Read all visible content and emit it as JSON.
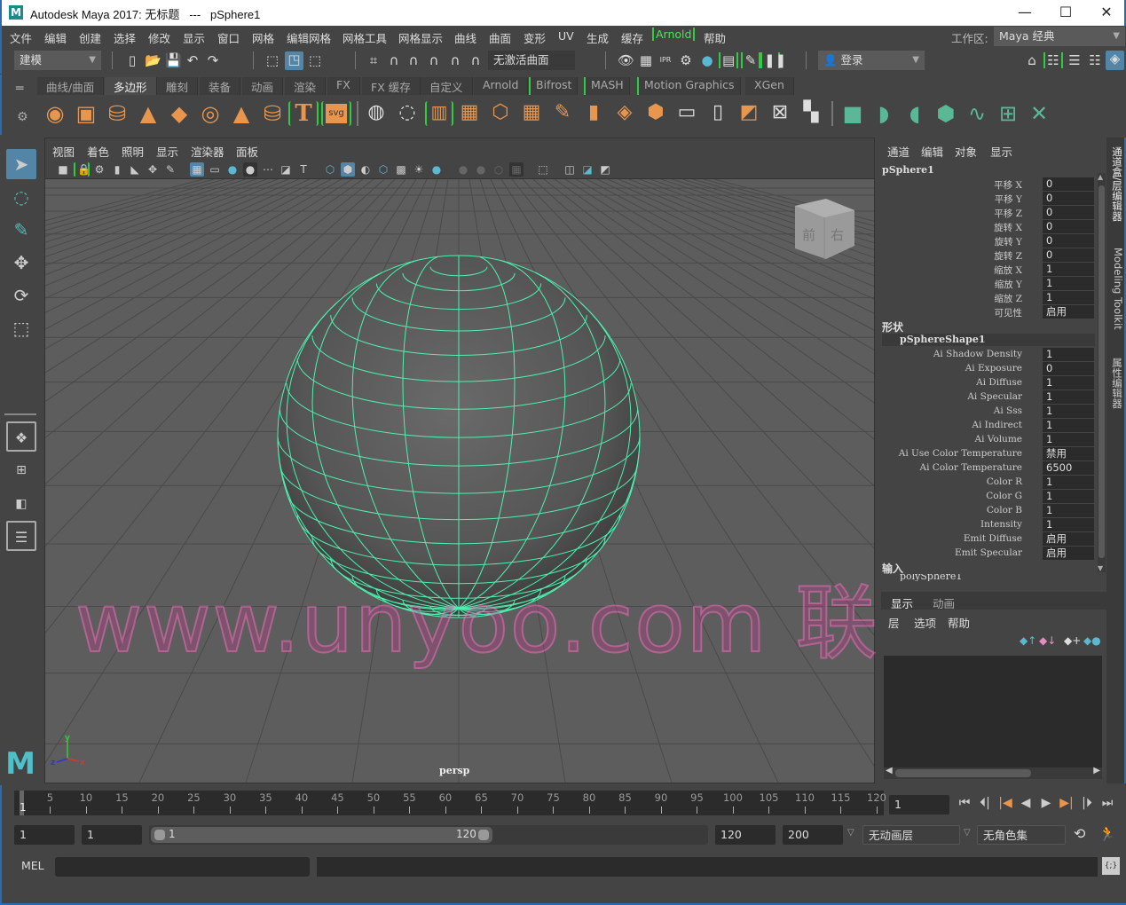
{
  "window": {
    "title": "Autodesk Maya 2017: 无标题   ---   pSphere1",
    "logo": "M",
    "minimize": "—",
    "maximize": "☐",
    "close": "✕"
  },
  "menubar": {
    "items": [
      "文件",
      "编辑",
      "创建",
      "选择",
      "修改",
      "显示",
      "窗口",
      "网格",
      "编辑网格",
      "网格工具",
      "网格显示",
      "曲线",
      "曲面",
      "变形",
      "UV",
      "生成",
      "缓存",
      "Arnold",
      "帮助"
    ],
    "workspace_label": "工作区:",
    "workspace_value": "Maya 经典"
  },
  "statusline": {
    "mode": "建模",
    "live_surface": "无激活曲面",
    "login": "登录"
  },
  "shelf": {
    "tabs": [
      "曲线/曲面",
      "多边形",
      "雕刻",
      "装备",
      "动画",
      "渲染",
      "FX",
      "FX 缓存",
      "自定义",
      "Arnold",
      "Bifrost",
      "MASH",
      "Motion Graphics",
      "XGen"
    ],
    "active_tab": "多边形",
    "text_icon": "T",
    "svg_icon": "svg"
  },
  "viewport": {
    "menus": [
      "视图",
      "着色",
      "照明",
      "显示",
      "渲染器",
      "面板"
    ],
    "camera_label": "persp",
    "viewcube_front": "前",
    "viewcube_right": "右",
    "axis_x": "x",
    "axis_y": "y",
    "axis_z": "z"
  },
  "channel_box": {
    "menus": [
      "通道",
      "编辑",
      "对象",
      "显示"
    ],
    "object_name": "pSphere1",
    "transform": [
      {
        "label": "平移 X",
        "value": "0"
      },
      {
        "label": "平移 Y",
        "value": "0"
      },
      {
        "label": "平移 Z",
        "value": "0"
      },
      {
        "label": "旋转 X",
        "value": "0"
      },
      {
        "label": "旋转 Y",
        "value": "0"
      },
      {
        "label": "旋转 Z",
        "value": "0"
      },
      {
        "label": "缩放 X",
        "value": "1"
      },
      {
        "label": "缩放 Y",
        "value": "1"
      },
      {
        "label": "缩放 Z",
        "value": "1"
      },
      {
        "label": "可见性",
        "value": "启用"
      }
    ],
    "shapes_heading": "形状",
    "shape_name": "pSphereShape1",
    "shape_attrs": [
      {
        "label": "Ai Shadow Density",
        "value": "1"
      },
      {
        "label": "Ai Exposure",
        "value": "0"
      },
      {
        "label": "Ai Diffuse",
        "value": "1"
      },
      {
        "label": "Ai Specular",
        "value": "1"
      },
      {
        "label": "Ai Sss",
        "value": "1"
      },
      {
        "label": "Ai Indirect",
        "value": "1"
      },
      {
        "label": "Ai Volume",
        "value": "1"
      },
      {
        "label": "Ai Use Color Temperature",
        "value": "禁用"
      },
      {
        "label": "Ai Color Temperature",
        "value": "6500"
      },
      {
        "label": "Color R",
        "value": "1"
      },
      {
        "label": "Color G",
        "value": "1"
      },
      {
        "label": "Color B",
        "value": "1"
      },
      {
        "label": "Intensity",
        "value": "1"
      },
      {
        "label": "Emit Diffuse",
        "value": "启用"
      },
      {
        "label": "Emit Specular",
        "value": "启用"
      }
    ],
    "inputs_heading": "输入",
    "input_node": "polySphere1"
  },
  "layer_editor": {
    "tabs": [
      "显示",
      "动画"
    ],
    "menus": [
      "层",
      "选项",
      "帮助"
    ]
  },
  "side_tabs": [
    "通道盒/层编辑器",
    "Modeling Toolkit",
    "属性编辑器"
  ],
  "time_slider": {
    "ticks": [
      5,
      10,
      15,
      20,
      25,
      30,
      35,
      40,
      45,
      50,
      55,
      60,
      65,
      70,
      75,
      80,
      85,
      90,
      95,
      100,
      105,
      110,
      115,
      120
    ],
    "range_min": 1,
    "range_max": 120,
    "current_frame_marker": "1",
    "current_frame": "1"
  },
  "range_slider": {
    "start": "1",
    "playback_start": "1",
    "slider_start": "1",
    "slider_end": "120",
    "playback_end": "120",
    "end": "200",
    "anim_layer": "无动画层",
    "character_set": "无角色集"
  },
  "command_line": {
    "language": "MEL"
  },
  "watermark": "www.unyoo.com 联合优网",
  "colors": {
    "accent_blue": "#5285a6",
    "wireframe_green": "#4ef0b0",
    "arnold_green": "#2ecc40",
    "shelf_orange": "#e8964e",
    "shelf_teal": "#5ab896"
  }
}
